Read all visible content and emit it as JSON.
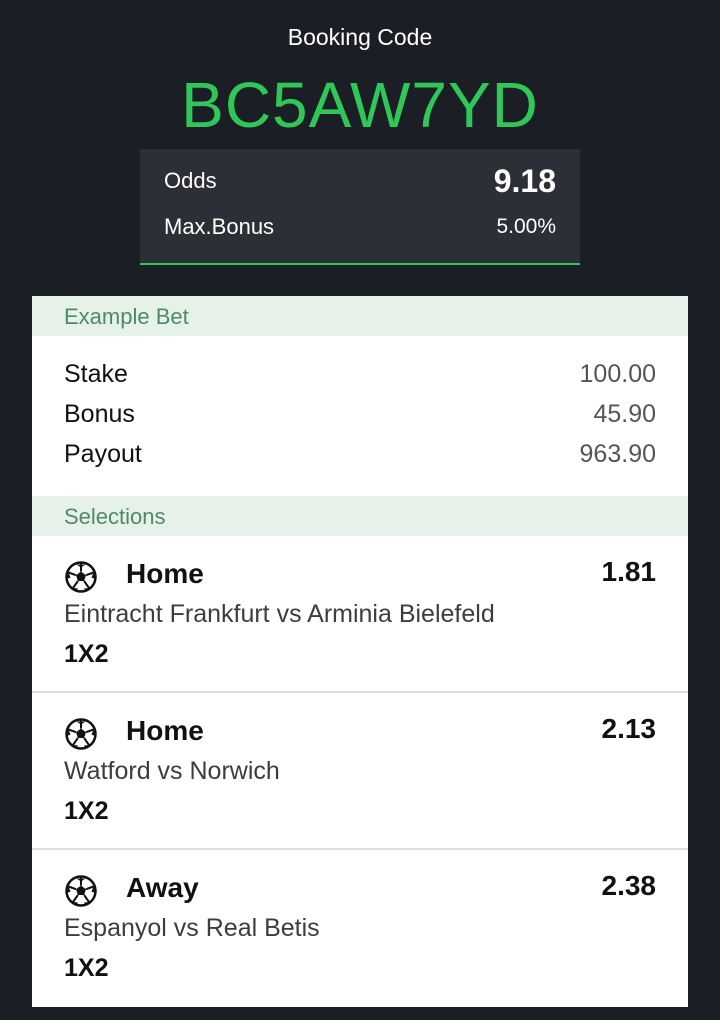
{
  "header": {
    "booking_label": "Booking Code",
    "booking_code": "BC5AW7YD"
  },
  "summary": {
    "odds_label": "Odds",
    "odds_value": "9.18",
    "bonus_label": "Max.Bonus",
    "bonus_value": "5.00%"
  },
  "example_bet": {
    "title": "Example Bet",
    "rows": [
      {
        "label": "Stake",
        "value": "100.00"
      },
      {
        "label": "Bonus",
        "value": "45.90"
      },
      {
        "label": "Payout",
        "value": "963.90"
      }
    ]
  },
  "selections": {
    "title": "Selections",
    "items": [
      {
        "icon": "soccer-ball-icon",
        "pick": "Home",
        "odds": "1.81",
        "match": "Eintracht Frankfurt vs Arminia Bielefeld",
        "market": "1X2"
      },
      {
        "icon": "soccer-ball-icon",
        "pick": "Home",
        "odds": "2.13",
        "match": "Watford vs Norwich",
        "market": "1X2"
      },
      {
        "icon": "soccer-ball-icon",
        "pick": "Away",
        "odds": "2.38",
        "match": "Espanyol vs Real Betis",
        "market": "1X2"
      }
    ]
  },
  "colors": {
    "background": "#1c1e25",
    "accent_green": "#2fc858",
    "section_header_bg": "#e6f2e9",
    "section_header_text": "#4d8b63"
  }
}
